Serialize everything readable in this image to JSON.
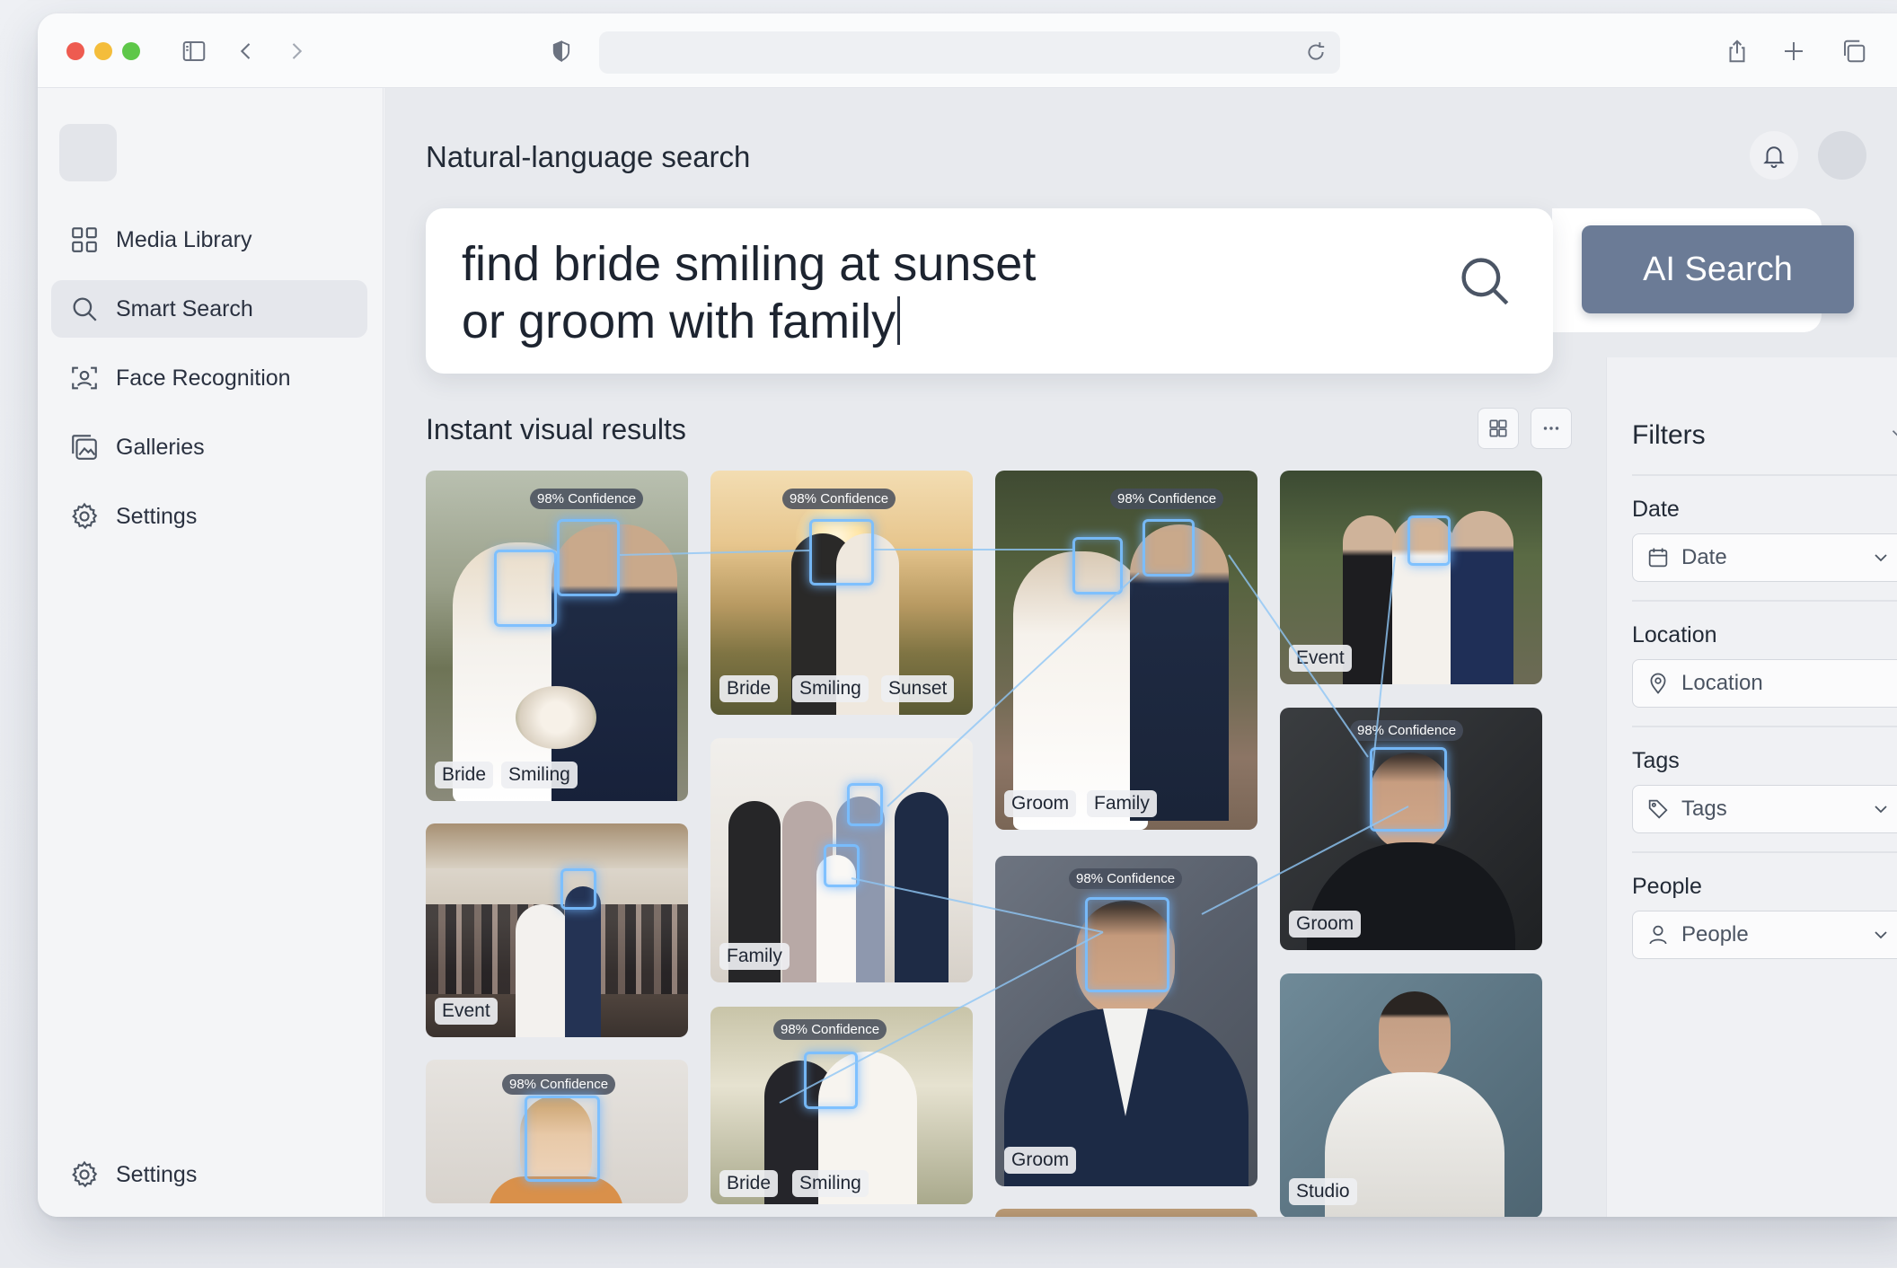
{
  "browser": {
    "url": ""
  },
  "sidebar": {
    "items": [
      {
        "label": "Media Library",
        "icon": "grid-icon"
      },
      {
        "label": "Smart Search",
        "icon": "search-icon",
        "active": true
      },
      {
        "label": "Face Recognition",
        "icon": "face-scan-icon"
      },
      {
        "label": "Galleries",
        "icon": "gallery-icon"
      },
      {
        "label": "Settings",
        "icon": "gear-icon"
      }
    ],
    "footer_settings": "Settings"
  },
  "main": {
    "title": "Natural-language search",
    "search": {
      "query": "find bride smiling at sunset\nor groom with family",
      "button": "AI Search"
    },
    "results_title": "Instant visual results"
  },
  "photos": [
    {
      "id": "p1",
      "confidence": "98% Confidence",
      "tags": [
        "Bride",
        "Smiling"
      ]
    },
    {
      "id": "p2",
      "confidence": "98% Confidence",
      "tags": [
        "Bride",
        "Smiling",
        "Sunset"
      ]
    },
    {
      "id": "p3",
      "confidence": "98% Confidence",
      "tags": [
        "Groom",
        "Family"
      ]
    },
    {
      "id": "p4",
      "confidence": "",
      "tags": [
        "Event"
      ]
    },
    {
      "id": "p5",
      "confidence": "",
      "tags": [
        "Event"
      ]
    },
    {
      "id": "p6",
      "confidence": "",
      "tags": [
        "Family"
      ]
    },
    {
      "id": "p7",
      "confidence": "98% Confidence",
      "tags": [
        "Groom"
      ]
    },
    {
      "id": "p8",
      "confidence": "98% Confidence",
      "tags": [
        "Groom"
      ]
    },
    {
      "id": "p9",
      "confidence": "98% Confidence",
      "tags": []
    },
    {
      "id": "p10",
      "confidence": "98% Confidence",
      "tags": [
        "Bride",
        "Smiling"
      ]
    },
    {
      "id": "p11",
      "confidence": "",
      "tags": [
        "Studio"
      ]
    }
  ],
  "filters": {
    "title": "Filters",
    "date": {
      "label": "Date",
      "placeholder": "Date"
    },
    "location": {
      "label": "Location",
      "placeholder": "Location"
    },
    "tags": {
      "label": "Tags",
      "placeholder": "Tags"
    },
    "people": {
      "label": "People",
      "placeholder": "People"
    }
  },
  "colors": {
    "accent": "#6b7b96",
    "face_box": "#78beff"
  }
}
